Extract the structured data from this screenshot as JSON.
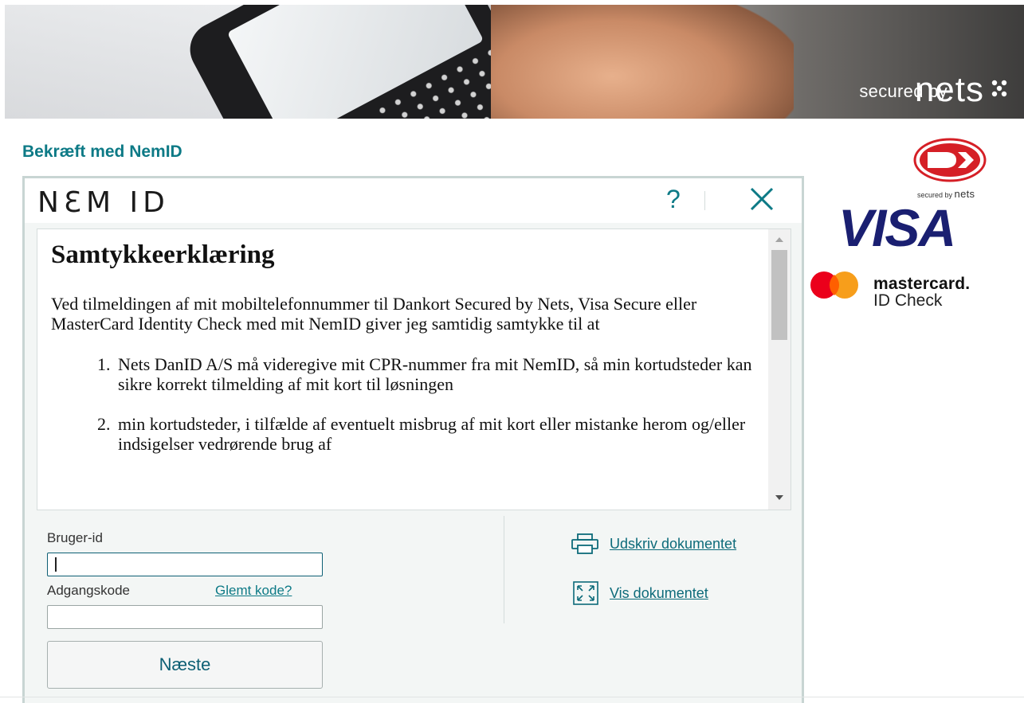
{
  "banner": {
    "secured_label": "secured by",
    "nets_label": "nets"
  },
  "heading": "Bekræft med NemID",
  "logos": {
    "dk_secured_small": "secured by",
    "dk_nets_small": "nets",
    "visa": "VISA",
    "mastercard_name": "mastercard.",
    "mastercard_sub": "ID Check"
  },
  "nemid": {
    "logo_text": "NƐM ID",
    "help_label": "?",
    "document": {
      "title": "Samtykkeerklæring",
      "intro": "Ved tilmeldingen af mit mobiltelefonnummer til Dankort Secured by Nets, Visa Secure eller MasterCard Identity Check med mit NemID giver jeg samtidig samtykke til at",
      "items": [
        "Nets DanID A/S må videregive mit CPR-nummer fra mit NemID, så min kortudsteder kan sikre korrekt tilmelding af mit kort til løsningen",
        "min kortudsteder, i tilfælde af eventuelt misbrug af mit kort eller mistanke herom og/eller indsigelser vedrørende brug af"
      ]
    },
    "login": {
      "user_label": "Bruger-id",
      "user_value": "",
      "password_label": "Adgangskode",
      "password_value": "",
      "forgot_label": "Glemt kode?",
      "next_label": "Næste"
    },
    "actions": {
      "print_label": "Udskriv dokumentet",
      "view_label": "Vis dokumentet"
    }
  },
  "colors": {
    "accent": "#0d7a86",
    "visa_blue": "#1a1f71",
    "dankort_red": "#d51f26",
    "mc_red": "#eb001b",
    "mc_orange": "#f79e1b"
  }
}
